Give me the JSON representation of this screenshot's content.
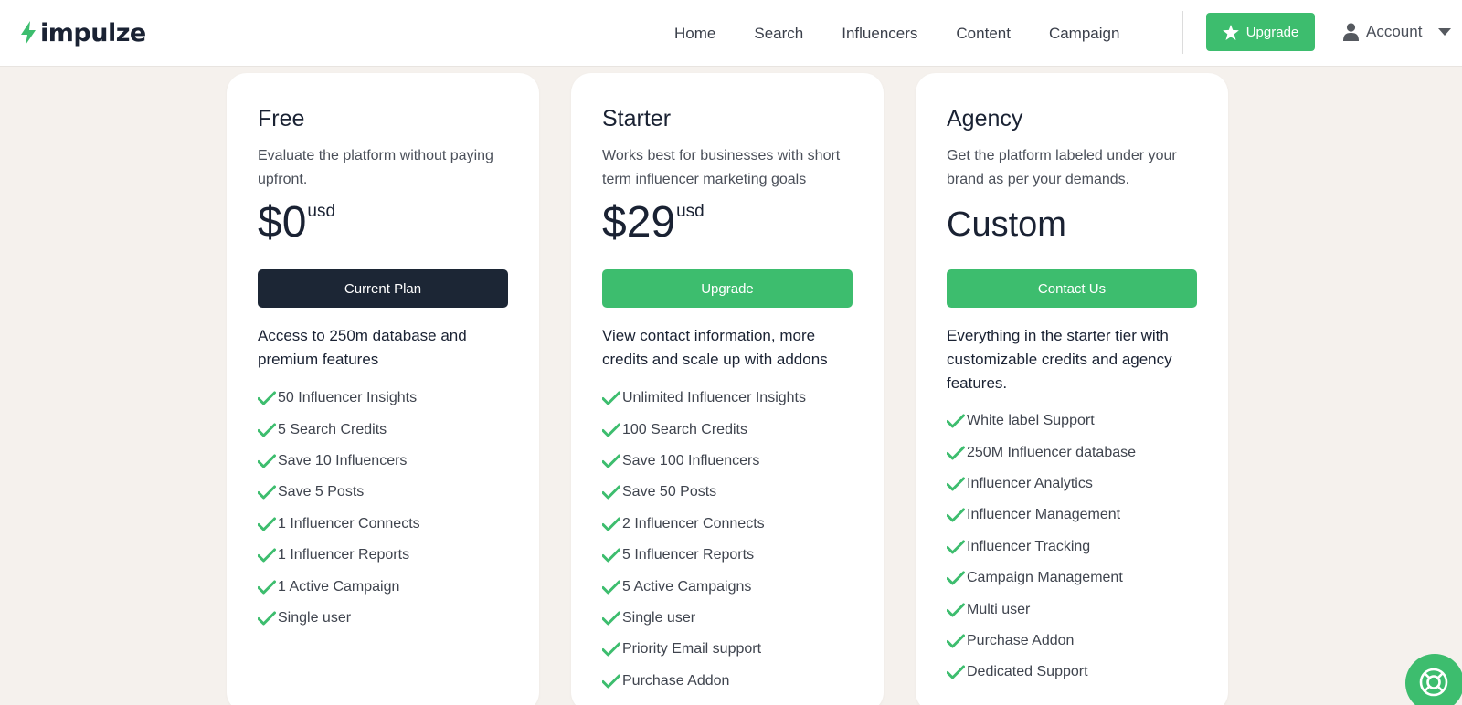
{
  "header": {
    "logo_text": "impulze",
    "nav": [
      "Home",
      "Search",
      "Influencers",
      "Content",
      "Campaign"
    ],
    "upgrade_label": "Upgrade",
    "account_label": "Account"
  },
  "plans": [
    {
      "name": "Free",
      "description": "Evaluate the platform without paying upfront.",
      "price": "$0",
      "currency": "usd",
      "button_label": "Current Plan",
      "summary": "Access to 250m database and premium features",
      "features": [
        "50 Influencer Insights",
        "5 Search Credits",
        "Save 10 Influencers",
        "Save 5 Posts",
        "1 Influencer Connects",
        "1 Influencer Reports",
        "1 Active Campaign",
        "Single user"
      ]
    },
    {
      "name": "Starter",
      "description": "Works best for businesses with short term influencer marketing goals",
      "price": "$29",
      "currency": "usd",
      "button_label": "Upgrade",
      "summary": "View contact information, more credits and scale up with addons",
      "features": [
        "Unlimited Influencer Insights",
        "100 Search Credits",
        "Save 100 Influencers",
        "Save 50 Posts",
        "2 Influencer Connects",
        "5 Influencer Reports",
        "5 Active Campaigns",
        "Single user",
        "Priority Email support",
        "Purchase Addon"
      ]
    },
    {
      "name": "Agency",
      "description": "Get the platform labeled under your brand as per your demands.",
      "price": "Custom",
      "button_label": "Contact Us",
      "summary": "Everything in the starter tier with customizable credits and agency features.",
      "features": [
        "White label Support",
        "250M Influencer database",
        "Influencer Analytics",
        "Influencer Management",
        "Influencer Tracking",
        "Campaign Management",
        "Multi user",
        "Purchase Addon",
        "Dedicated Support"
      ]
    }
  ],
  "colors": {
    "accent": "#3dbd6e",
    "dark_button": "#1c2635",
    "background": "#f5f1ed"
  }
}
